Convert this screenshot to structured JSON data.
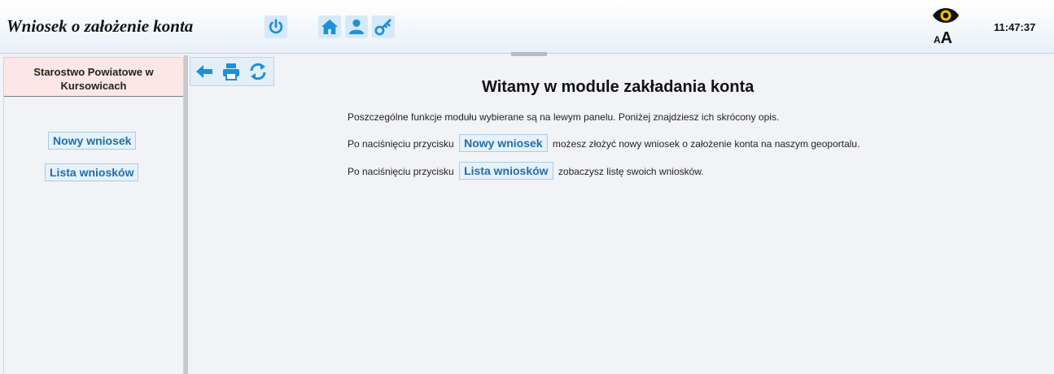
{
  "header": {
    "title": "Wniosek o założenie konta",
    "buttons": [
      {
        "icon": "power-icon"
      },
      {
        "icon": "home-icon"
      },
      {
        "icon": "user-icon"
      },
      {
        "icon": "key-icon"
      }
    ],
    "accessibility": {
      "eye_icon": "eye-icon",
      "font_size_small": "A",
      "font_size_big": "A"
    },
    "clock": "11:47:37"
  },
  "sidebar": {
    "organization": "Starostwo Powiatowe w Kursowicach",
    "items": [
      {
        "label": "Nowy wniosek"
      },
      {
        "label": "Lista wniosków"
      }
    ]
  },
  "toolbar": {
    "buttons": [
      {
        "icon": "arrow-left-icon"
      },
      {
        "icon": "print-icon"
      },
      {
        "icon": "refresh-icon"
      }
    ]
  },
  "main": {
    "title": "Witamy w module zakładania konta",
    "intro": "Poszczególne funkcje modułu wybierane są na lewym panelu. Poniżej znajdziesz ich skrócony opis.",
    "line1": {
      "before": "Po naciśnięciu przycisku",
      "button": "Nowy wniosek",
      "after": "możesz złożyć nowy wniosek o założenie konta na naszym geoportalu."
    },
    "line2": {
      "before": "Po naciśnięciu przycisku",
      "button": "Lista wniosków",
      "after": "zobaczysz listę swoich wniosków."
    }
  },
  "colors": {
    "accent": "#1f6fa8",
    "button_bg": "#e6f1fa",
    "org_bg": "#fde6e6",
    "icon_blue": "#1e90d6"
  }
}
